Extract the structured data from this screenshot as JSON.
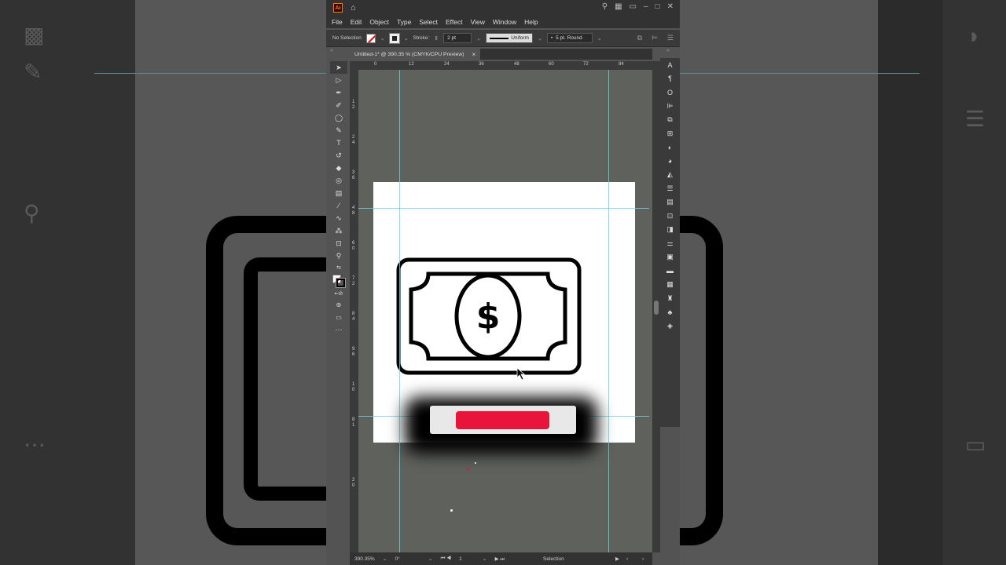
{
  "window": {
    "app_logo": "Ai",
    "title_icons": [
      "search-icon",
      "arrange-icon",
      "panel-icon",
      "minimize-icon",
      "maximize-icon",
      "close-icon"
    ]
  },
  "menu": {
    "items": [
      "File",
      "Edit",
      "Object",
      "Type",
      "Select",
      "Effect",
      "View",
      "Window",
      "Help"
    ]
  },
  "control": {
    "selection_label": "No Selection",
    "stroke_label": "Stroke:",
    "stroke_weight": "2 pt",
    "profile_label": "Uniform",
    "brush_label": "5 pt. Round"
  },
  "document": {
    "tab_title": "Untitled-1* @ 390.35 % (CMYK/CPU Preview)",
    "close_glyph": "×"
  },
  "ruler": {
    "top_ticks": [
      "0",
      "12",
      "24",
      "36",
      "48",
      "60",
      "72",
      "84"
    ],
    "left_ticks": [
      "1",
      "2",
      "2",
      "4",
      "3",
      "6",
      "4",
      "8",
      "6",
      "0",
      "7",
      "2",
      "8",
      "4",
      "9",
      "6",
      "1",
      "0",
      "8",
      "1",
      "2",
      "0"
    ]
  },
  "artboard": {
    "icon_name": "dollar-bill-icon",
    "currency_symbol": "$"
  },
  "status": {
    "zoom": "390.35%",
    "rotation": "0°",
    "artboard_number": "1",
    "tool_name": "Selection"
  },
  "colors": {
    "accent_red": "#e8143c",
    "guide_cyan": "#6ad2e6",
    "artboard": "#ffffff",
    "stroke": "#000000"
  }
}
